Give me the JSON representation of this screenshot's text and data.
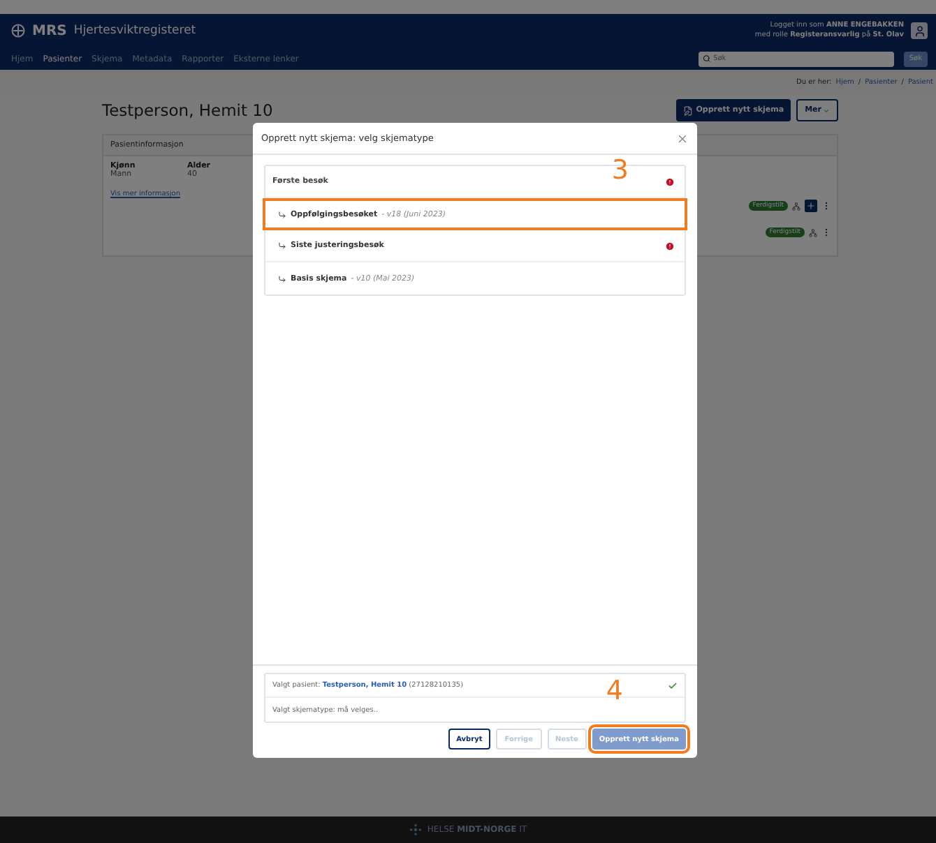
{
  "header": {
    "logo": "MRS",
    "title": "Hjertesviktregisteret",
    "user_line_1": "Logget inn som **ANNE ENGEBAKKEN**",
    "user_line_2": "med rolle **Registeransvarlig** på **St. Olav**"
  },
  "nav": [
    {
      "label": "Hjem",
      "selected": false
    },
    {
      "label": "Pasienter",
      "selected": true
    },
    {
      "label": "Skjema",
      "selected": false
    },
    {
      "label": "Metadata",
      "selected": false
    },
    {
      "label": "Rapporter",
      "selected": false
    },
    {
      "label": "Eksterne lenker",
      "selected": false
    }
  ],
  "search": {
    "placeholder": "Søk",
    "button": "Søk"
  },
  "breadcrumb": {
    "prefix": "Du er her:",
    "items": [
      "Hjem",
      "Pasienter",
      "Pasient"
    ],
    "separator": "/"
  },
  "patient": {
    "name": "Testperson, Hemit 10",
    "create_button": "Opprett nytt skjema",
    "more_button": "Mer",
    "card_title": "Pasientinformasjon",
    "fields": [
      {
        "label": "Kjønn",
        "value": "Mann"
      },
      {
        "label": "Alder",
        "value": "40"
      }
    ],
    "more_link": "Vis mer informasjon",
    "forms": [
      {
        "status": "Ferdigstilt",
        "addable": true
      },
      {
        "status": "Ferdigstilt",
        "addable": false
      }
    ]
  },
  "modal": {
    "title": "Opprett nytt skjema: velg skjematype",
    "group": {
      "name": "Første besøk",
      "warning": true
    },
    "items": [
      {
        "name": "Oppfølgingsbesøket",
        "meta": "- v18 (Juni 2023)",
        "warning": false,
        "annotation": "3"
      },
      {
        "name": "Siste justeringsbesøk",
        "warning": true
      },
      {
        "name": "Basis skjema",
        "meta": "- v10 (Mai 2023)",
        "warning": false
      }
    ],
    "patient_line": "Valgt pasient: **Testperson, Hemit 10** (27128210135)",
    "patient_ok": true,
    "type_line": "Valgt skjematype: må velges..",
    "buttons": [
      {
        "label": "Avbryt",
        "disabled": false
      },
      {
        "label": "Forrige",
        "disabled": true
      },
      {
        "label": "Neste",
        "disabled": true
      },
      {
        "label": "Opprett nytt skjema",
        "disabled": true,
        "primary": true,
        "annotation": "4"
      }
    ]
  },
  "footer": "HELSE **MIDT-NORGE** IT"
}
